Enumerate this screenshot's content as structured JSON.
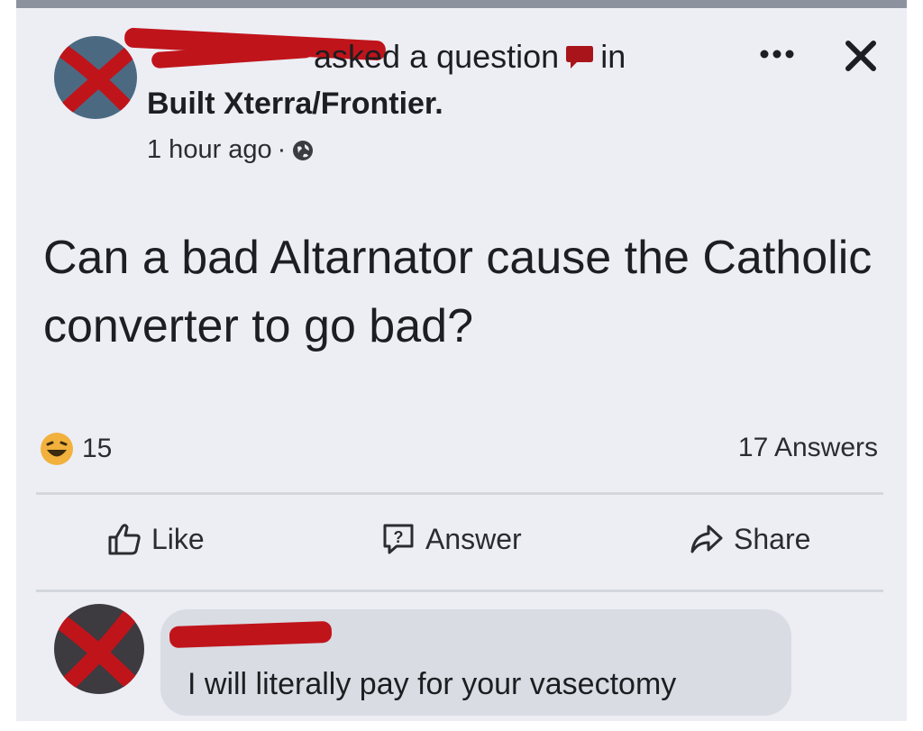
{
  "post": {
    "header_action": "asked a question",
    "header_in": "in",
    "group_name": "Built Xterra/Frontier.",
    "timestamp": "1 hour ago",
    "separator": "·",
    "question": "Can a bad Altarnator cause the Catholic converter to go bad?",
    "reaction_count": "15",
    "answers_count": "17 Answers"
  },
  "actions": {
    "like": "Like",
    "answer": "Answer",
    "share": "Share"
  },
  "comment": {
    "text": "I will literally pay for your vasectomy"
  },
  "colors": {
    "redaction": "#c0141b",
    "card_background": "#eceef4",
    "comment_bubble": "#d9dce3",
    "text": "#1c1e21"
  },
  "icons": {
    "more": "more-dots-icon",
    "close": "close-icon",
    "privacy": "globe-icon",
    "reaction": "haha-reaction-icon",
    "like": "thumbs-up-icon",
    "answer": "question-bubble-icon",
    "share": "share-arrow-icon",
    "question_type": "comment-bubble-icon"
  }
}
